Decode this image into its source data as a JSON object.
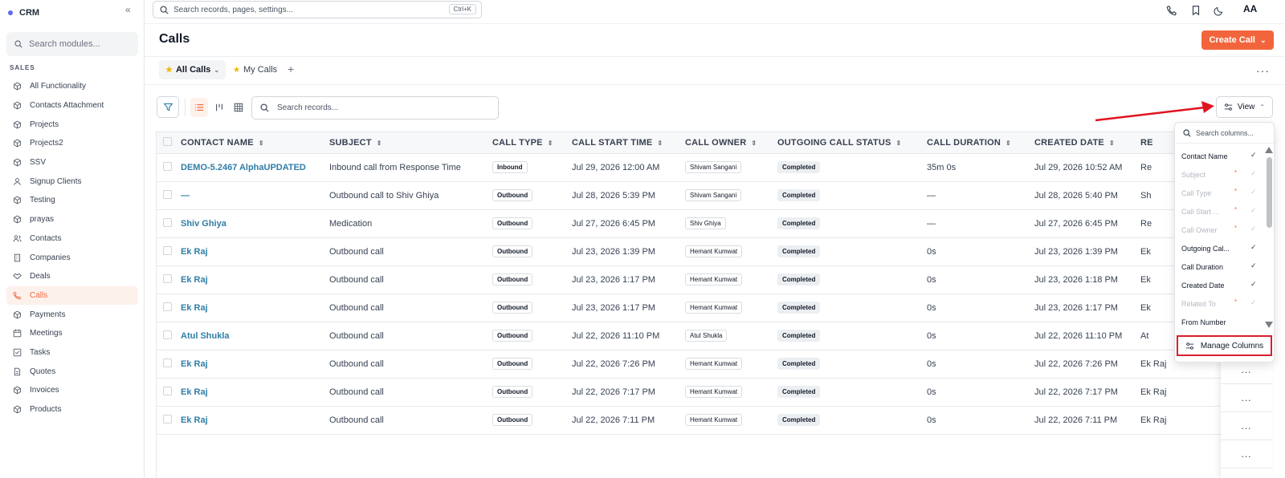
{
  "app": {
    "name": "CRM"
  },
  "sidebar": {
    "search_placeholder": "Search modules...",
    "section": "SALES",
    "items": [
      {
        "label": "All Functionality",
        "icon": "cube-icon"
      },
      {
        "label": "Contacts Attachment",
        "icon": "cube-icon"
      },
      {
        "label": "Projects",
        "icon": "cube-icon"
      },
      {
        "label": "Projects2",
        "icon": "cube-icon"
      },
      {
        "label": "SSV",
        "icon": "cube-icon"
      },
      {
        "label": "Signup Clients",
        "icon": "user-icon"
      },
      {
        "label": "Testing",
        "icon": "cube-icon"
      },
      {
        "label": "prayas",
        "icon": "cube-icon"
      },
      {
        "label": "Contacts",
        "icon": "users-icon"
      },
      {
        "label": "Companies",
        "icon": "building-icon"
      },
      {
        "label": "Deals",
        "icon": "handshake-icon"
      },
      {
        "label": "Calls",
        "icon": "phone-icon",
        "active": true
      },
      {
        "label": "Payments",
        "icon": "cube-icon"
      },
      {
        "label": "Meetings",
        "icon": "calendar-icon"
      },
      {
        "label": "Tasks",
        "icon": "checkbox-icon"
      },
      {
        "label": "Quotes",
        "icon": "document-icon"
      },
      {
        "label": "Invoices",
        "icon": "cube-icon"
      },
      {
        "label": "Products",
        "icon": "cube-icon"
      }
    ]
  },
  "topbar": {
    "search_placeholder": "Search records, pages, settings...",
    "shortcut": "Ctrl+K",
    "avatar": "AA"
  },
  "page": {
    "title": "Calls",
    "create_label": "Create Call"
  },
  "tabs": [
    {
      "label": "All Calls",
      "active": true
    },
    {
      "label": "My Calls",
      "active": false
    }
  ],
  "toolbar": {
    "search_placeholder": "Search records...",
    "view_label": "View"
  },
  "table": {
    "columns": [
      "CONTACT NAME",
      "SUBJECT",
      "CALL TYPE",
      "CALL START TIME",
      "CALL OWNER",
      "OUTGOING CALL STATUS",
      "CALL DURATION",
      "CREATED DATE",
      "RE"
    ],
    "rows": [
      {
        "contact": "DEMO-5.2467 AlphaUPDATED",
        "subject": "Inbound call from Response Time",
        "type": "Inbound",
        "start": "Jul 29, 2026 12:00 AM",
        "owner": "Shivam Sangani",
        "status": "Completed",
        "duration": "35m 0s",
        "created": "Jul 29, 2026 10:52 AM",
        "related": "Re"
      },
      {
        "contact": "—",
        "subject": "Outbound call to Shiv Ghiya",
        "type": "Outbound",
        "start": "Jul 28, 2026 5:39 PM",
        "owner": "Shivam Sangani",
        "status": "Completed",
        "duration": "—",
        "created": "Jul 28, 2026 5:40 PM",
        "related": "Sh"
      },
      {
        "contact": "Shiv Ghiya",
        "subject": "Medication",
        "type": "Outbound",
        "start": "Jul 27, 2026 6:45 PM",
        "owner": "Shiv Ghiya",
        "status": "Completed",
        "duration": "—",
        "created": "Jul 27, 2026 6:45 PM",
        "related": "Re"
      },
      {
        "contact": "Ek Raj",
        "subject": "Outbound call",
        "type": "Outbound",
        "start": "Jul 23, 2026 1:39 PM",
        "owner": "Hemant Kumwat",
        "status": "Completed",
        "duration": "0s",
        "created": "Jul 23, 2026 1:39 PM",
        "related": "Ek"
      },
      {
        "contact": "Ek Raj",
        "subject": "Outbound call",
        "type": "Outbound",
        "start": "Jul 23, 2026 1:17 PM",
        "owner": "Hemant Kumwat",
        "status": "Completed",
        "duration": "0s",
        "created": "Jul 23, 2026 1:18 PM",
        "related": "Ek"
      },
      {
        "contact": "Ek Raj",
        "subject": "Outbound call",
        "type": "Outbound",
        "start": "Jul 23, 2026 1:17 PM",
        "owner": "Hemant Kumwat",
        "status": "Completed",
        "duration": "0s",
        "created": "Jul 23, 2026 1:17 PM",
        "related": "Ek"
      },
      {
        "contact": "Atul Shukla",
        "subject": "Outbound call",
        "type": "Outbound",
        "start": "Jul 22, 2026 11:10 PM",
        "owner": "Atul Shukla",
        "status": "Completed",
        "duration": "0s",
        "created": "Jul 22, 2026 11:10 PM",
        "related": "At"
      },
      {
        "contact": "Ek Raj",
        "subject": "Outbound call",
        "type": "Outbound",
        "start": "Jul 22, 2026 7:26 PM",
        "owner": "Hemant Kumwat",
        "status": "Completed",
        "duration": "0s",
        "created": "Jul 22, 2026 7:26 PM",
        "related": "Ek Raj"
      },
      {
        "contact": "Ek Raj",
        "subject": "Outbound call",
        "type": "Outbound",
        "start": "Jul 22, 2026 7:17 PM",
        "owner": "Hemant Kumwat",
        "status": "Completed",
        "duration": "0s",
        "created": "Jul 22, 2026 7:17 PM",
        "related": "Ek Raj"
      },
      {
        "contact": "Ek Raj",
        "subject": "Outbound call",
        "type": "Outbound",
        "start": "Jul 22, 2026 7:11 PM",
        "owner": "Hemant Kumwat",
        "status": "Completed",
        "duration": "0s",
        "created": "Jul 22, 2026 7:11 PM",
        "related": "Ek Raj"
      }
    ],
    "row_actions": [
      "...",
      "...",
      "...",
      "..."
    ]
  },
  "column_menu": {
    "search_placeholder": "Search columns...",
    "items": [
      {
        "label": "Contact Name",
        "required": false,
        "checked": true,
        "disabled": false
      },
      {
        "label": "Subject",
        "required": true,
        "checked": true,
        "disabled": true
      },
      {
        "label": "Call Type",
        "required": true,
        "checked": true,
        "disabled": true
      },
      {
        "label": "Call Start ...",
        "required": true,
        "checked": true,
        "disabled": true
      },
      {
        "label": "Call Owner",
        "required": true,
        "checked": true,
        "disabled": true
      },
      {
        "label": "Outgoing Cal...",
        "required": false,
        "checked": true,
        "disabled": false
      },
      {
        "label": "Call Duration",
        "required": false,
        "checked": true,
        "disabled": false
      },
      {
        "label": "Created Date",
        "required": false,
        "checked": true,
        "disabled": false
      },
      {
        "label": "Related To",
        "required": true,
        "checked": true,
        "disabled": true
      },
      {
        "label": "From Number",
        "required": false,
        "checked": false,
        "disabled": false
      }
    ],
    "manage_label": "Manage Columns"
  },
  "colors": {
    "accent": "#f2653c",
    "link": "#2f7ea6",
    "highlight": "#d9202b"
  }
}
